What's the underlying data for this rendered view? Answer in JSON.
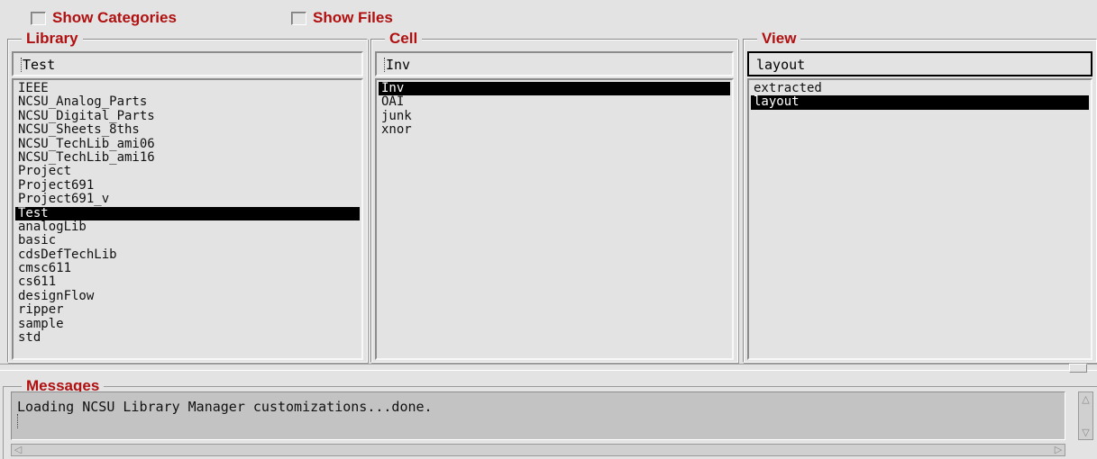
{
  "options": {
    "show_categories": "Show Categories",
    "show_files": "Show Files"
  },
  "library": {
    "title": "Library",
    "value": "Test",
    "items": [
      "IEEE",
      "NCSU_Analog_Parts",
      "NCSU_Digital_Parts",
      "NCSU_Sheets_8ths",
      "NCSU_TechLib_ami06",
      "NCSU_TechLib_ami16",
      "Project",
      "Project691",
      "Project691_v",
      "Test",
      "analogLib",
      "basic",
      "cdsDefTechLib",
      "cmsc611",
      "cs611",
      "designFlow",
      "ripper",
      "sample",
      "std"
    ],
    "selected": "Test"
  },
  "cell": {
    "title": "Cell",
    "value": "Inv",
    "items": [
      "Inv",
      "OAI",
      "junk",
      "xnor"
    ],
    "selected": "Inv"
  },
  "view": {
    "title": "View",
    "value": "layout",
    "items": [
      "extracted",
      "layout"
    ],
    "selected": "layout"
  },
  "messages": {
    "title": "Messages",
    "text": "Loading NCSU Library Manager customizations...done."
  },
  "colors": {
    "header_red": "#b01010",
    "background": "#e3e3e3",
    "selection": "#000000"
  }
}
